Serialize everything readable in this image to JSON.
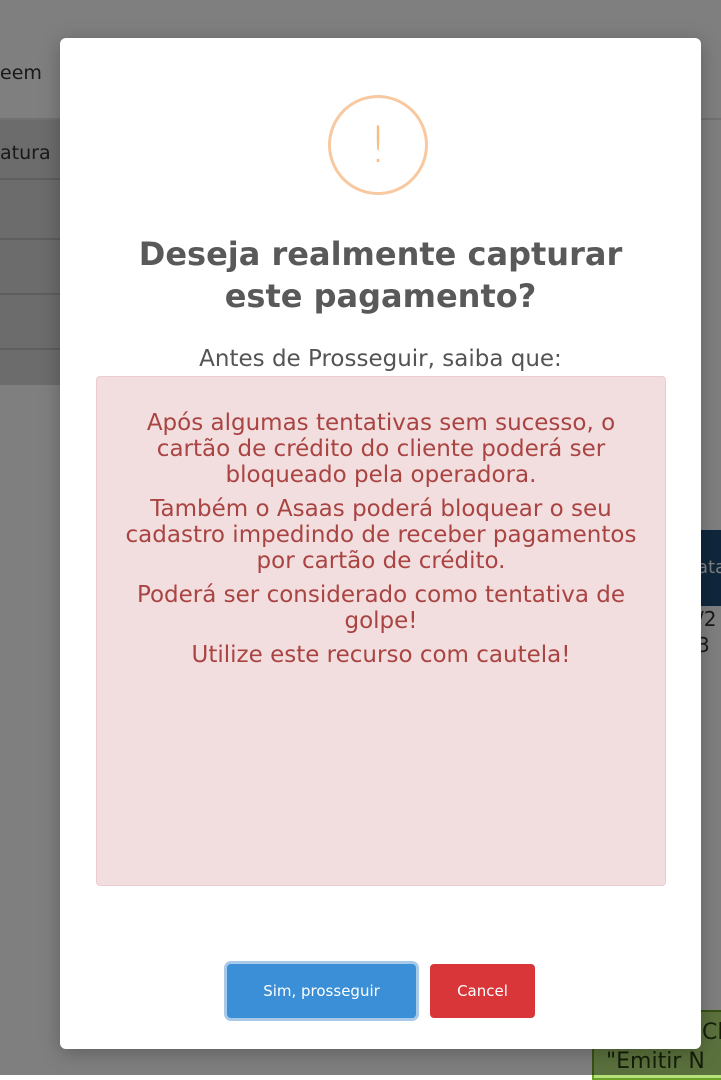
{
  "background": {
    "partial_text_1": "eem",
    "partial_text_2": "atura",
    "right_header": "ata",
    "right_cell_1": "/2",
    "right_cell_2": "3",
    "green_button_line1": "Cli",
    "green_button_line2": "\"Emitir N"
  },
  "dialog": {
    "icon": "exclamation-icon",
    "icon_glyph": "!",
    "title": "Deseja realmente capturar este pagamento?",
    "subtitle": "Antes de Prosseguir, saiba que:",
    "warnings": [
      "Após algumas tentativas sem sucesso, o cartão de crédito do cliente poderá ser bloqueado pela operadora.",
      "Também o Asaas poderá bloquear o seu cadastro impedindo de receber pagamentos por cartão de crédito.",
      "Poderá ser considerado como tentativa de golpe!",
      "Utilize este recurso com cautela!"
    ],
    "confirm_label": "Sim, prosseguir",
    "cancel_label": "Cancel"
  },
  "colors": {
    "warning_icon": "#f8bb86",
    "alert_bg": "#f2dede",
    "alert_text": "#a94442",
    "confirm_button": "#3b8fd6",
    "cancel_button": "#d9363a"
  }
}
